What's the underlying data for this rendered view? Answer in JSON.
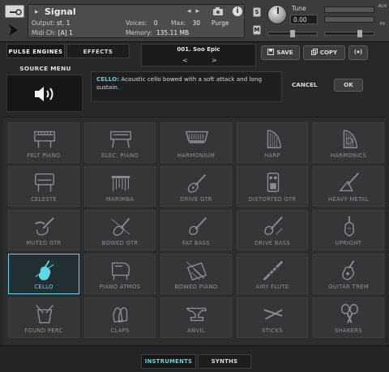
{
  "header": {
    "instrument_name": "Signal",
    "output_label": "Output:",
    "output_value": "st. 1",
    "voices_label": "Voices:",
    "voices_value": "0",
    "max_label": "Max:",
    "max_value": "30",
    "purge_label": "Purge",
    "midi_label": "Midi Ch:",
    "midi_value": "[A]  1",
    "memory_label": "Memory:",
    "memory_value": "135.11 MB",
    "solo_label": "S",
    "mute_label": "M",
    "tune_label": "Tune",
    "tune_value": "0.00",
    "side_tags": [
      "AUX",
      "PV"
    ]
  },
  "tabs": {
    "pulse_engines": "PULSE ENGINES",
    "effects": "EFFECTS"
  },
  "preset": {
    "name": "001. Soo Epic",
    "prev": "<",
    "next": ">"
  },
  "buttons": {
    "save": "SAVE",
    "copy": "COPY"
  },
  "source_menu": {
    "label": "SOURCE MENU"
  },
  "description": {
    "highlight": "CELLO:",
    "text": " Acoustic cello bowed with a soft attack and long sustain."
  },
  "dialog": {
    "cancel": "CANCEL",
    "ok": "OK"
  },
  "instruments": [
    {
      "label": "FELT PIANO",
      "icon": "piano-icon"
    },
    {
      "label": "ELEC. PIANO",
      "icon": "elec-piano-icon"
    },
    {
      "label": "HARMONIUM",
      "icon": "harmonium-icon"
    },
    {
      "label": "HARP",
      "icon": "harp-icon"
    },
    {
      "label": "HARMONICS",
      "icon": "harp-harmonics-icon"
    },
    {
      "label": "CELESTE",
      "icon": "celeste-icon"
    },
    {
      "label": "MARIMBA",
      "icon": "marimba-icon"
    },
    {
      "label": "DRIVE GTR",
      "icon": "guitar-icon"
    },
    {
      "label": "DISTORTED GTR",
      "icon": "pedal-icon"
    },
    {
      "label": "HEAVY METAL",
      "icon": "flying-v-icon"
    },
    {
      "label": "MUTED GTR",
      "icon": "muted-guitar-icon"
    },
    {
      "label": "BOWED GTR",
      "icon": "bowed-guitar-icon"
    },
    {
      "label": "FAT BASS",
      "icon": "bass-icon"
    },
    {
      "label": "DRIVE BASS",
      "icon": "drive-bass-icon"
    },
    {
      "label": "UPRIGHT",
      "icon": "upright-bass-icon"
    },
    {
      "label": "CELLO",
      "icon": "cello-icon",
      "selected": true
    },
    {
      "label": "PIANO ATMOS",
      "icon": "grand-piano-icon"
    },
    {
      "label": "BOWED PIANO",
      "icon": "bowed-piano-icon"
    },
    {
      "label": "AIRY FLUTE",
      "icon": "flute-icon"
    },
    {
      "label": "GUITAR TREM",
      "icon": "acoustic-guitar-icon"
    },
    {
      "label": "FOUND PERC",
      "icon": "bucket-icon"
    },
    {
      "label": "CLAPS",
      "icon": "claps-icon"
    },
    {
      "label": "ANVIL",
      "icon": "anvil-icon"
    },
    {
      "label": "STICKS",
      "icon": "sticks-icon"
    },
    {
      "label": "SHAKERS",
      "icon": "maracas-icon"
    }
  ],
  "bottom_tabs": {
    "instruments": "INSTRUMENTS",
    "synths": "SYNTHS"
  },
  "colors": {
    "accent": "#5fd7e6",
    "background": "#262829"
  }
}
